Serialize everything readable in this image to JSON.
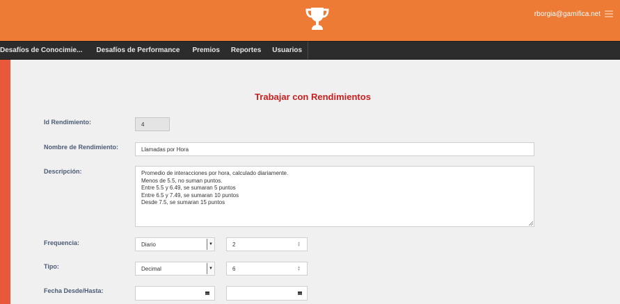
{
  "header": {
    "user_email": "rborgia@gamifica.net"
  },
  "nav": {
    "items": [
      {
        "label": "Desafíos de Conocimie..."
      },
      {
        "label": "Desafíos de Performance"
      },
      {
        "label": "Premios"
      },
      {
        "label": "Reportes"
      },
      {
        "label": "Usuarios"
      }
    ]
  },
  "page": {
    "title": "Trabajar con Rendimientos"
  },
  "form": {
    "id_label": "Id Rendimiento:",
    "id_value": "4",
    "name_label": "Nombre de Rendimiento:",
    "name_value": "Llamadas por Hora",
    "description_label": "Descripción:",
    "description_lines": [
      "Promedio de interacciones por hora, calculado diariamente.",
      "Menos de 5.5, no suman puntos.",
      "Entre 5.5 y 6.49, se sumaran 5 puntos",
      "Entre 6.5 y 7.49, se sumaran 10 puntos",
      "Desde 7.5, se sumaran 15 puntos"
    ],
    "frequency_label": "Frequencia:",
    "frequency_value": "Diario",
    "frequency_number": "2",
    "type_label": "Tipo:",
    "type_value": "Decimal",
    "type_number": "6",
    "date_label": "Fecha Desde/Hasta:",
    "date_from": "",
    "date_to": ""
  },
  "colors": {
    "header_bg": "#ed7a35",
    "outer_bg": "#e8583a",
    "nav_bg": "#2c2c2c",
    "title_color": "#c81e1e",
    "label_color": "#4a5a75"
  },
  "icons": {
    "logo": "trophy-icon",
    "menu": "hamburger-icon",
    "select_arrow": "caret-down-icon",
    "spinner": "spinner-arrows-icon",
    "calendar": "calendar-icon"
  }
}
